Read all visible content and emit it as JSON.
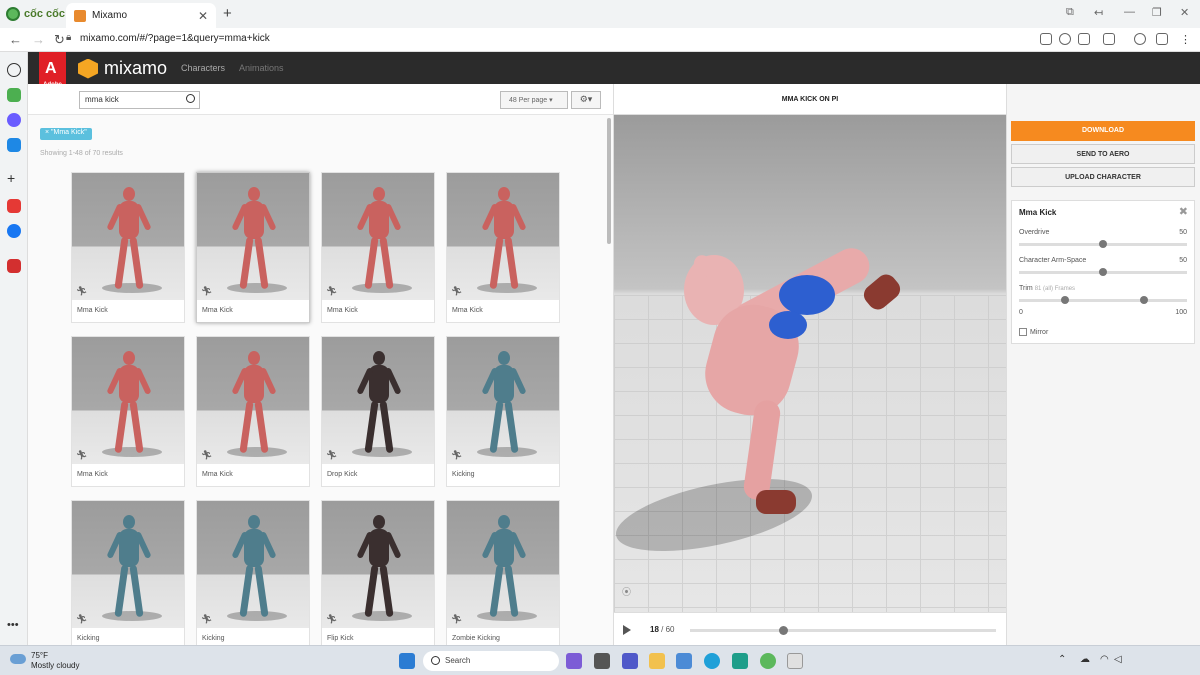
{
  "browser": {
    "brand": "cốc cốc",
    "tab_title": "Mixamo",
    "url": "mixamo.com/#/?page=1&query=mma+kick"
  },
  "mixamo": {
    "logo_text": "mixamo",
    "adobe_label": "Adobe",
    "nav": [
      "Characters",
      "Animations"
    ],
    "search_value": "mma kick",
    "per_page": "48 Per page",
    "filter_chip": "× \"Mma Kick\"",
    "results_count": "Showing 1-48 of 70 results",
    "cards": [
      {
        "label": "Mma Kick",
        "style": "red"
      },
      {
        "label": "Mma Kick",
        "style": "red"
      },
      {
        "label": "Mma Kick",
        "style": "red"
      },
      {
        "label": "Mma Kick",
        "style": "red"
      },
      {
        "label": "Mma Kick",
        "style": "red"
      },
      {
        "label": "Mma Kick",
        "style": "red"
      },
      {
        "label": "Drop Kick",
        "style": "dark"
      },
      {
        "label": "Kicking",
        "style": "teal"
      },
      {
        "label": "Kicking",
        "style": "teal"
      },
      {
        "label": "Kicking",
        "style": "teal"
      },
      {
        "label": "Flip Kick",
        "style": "dark"
      },
      {
        "label": "Zombie Kicking",
        "style": "teal"
      }
    ],
    "viewer": {
      "title": "MMA KICK ON PI",
      "frame_current": "18",
      "frame_total": "/ 60",
      "progress": 0.3
    },
    "actions": {
      "download": "DOWNLOAD",
      "send": "SEND TO AERO",
      "upload": "UPLOAD CHARACTER"
    },
    "settings": {
      "title": "Mma Kick",
      "overdrive_label": "Overdrive",
      "overdrive_value": "50",
      "armspace_label": "Character Arm-Space",
      "armspace_value": "50",
      "trim_label": "Trim",
      "trim_sub": "81 (all) Frames",
      "trim_min": "0",
      "trim_max": "100",
      "mirror_label": "Mirror"
    }
  },
  "taskbar": {
    "temp": "75°F",
    "weather": "Mostly cloudy",
    "search_placeholder": "Search"
  },
  "colors": {
    "accent_orange": "#f68a1f",
    "chip_blue": "#5bc0de",
    "header_dark": "#2b2b2b",
    "adobe_red": "#e01f26"
  }
}
